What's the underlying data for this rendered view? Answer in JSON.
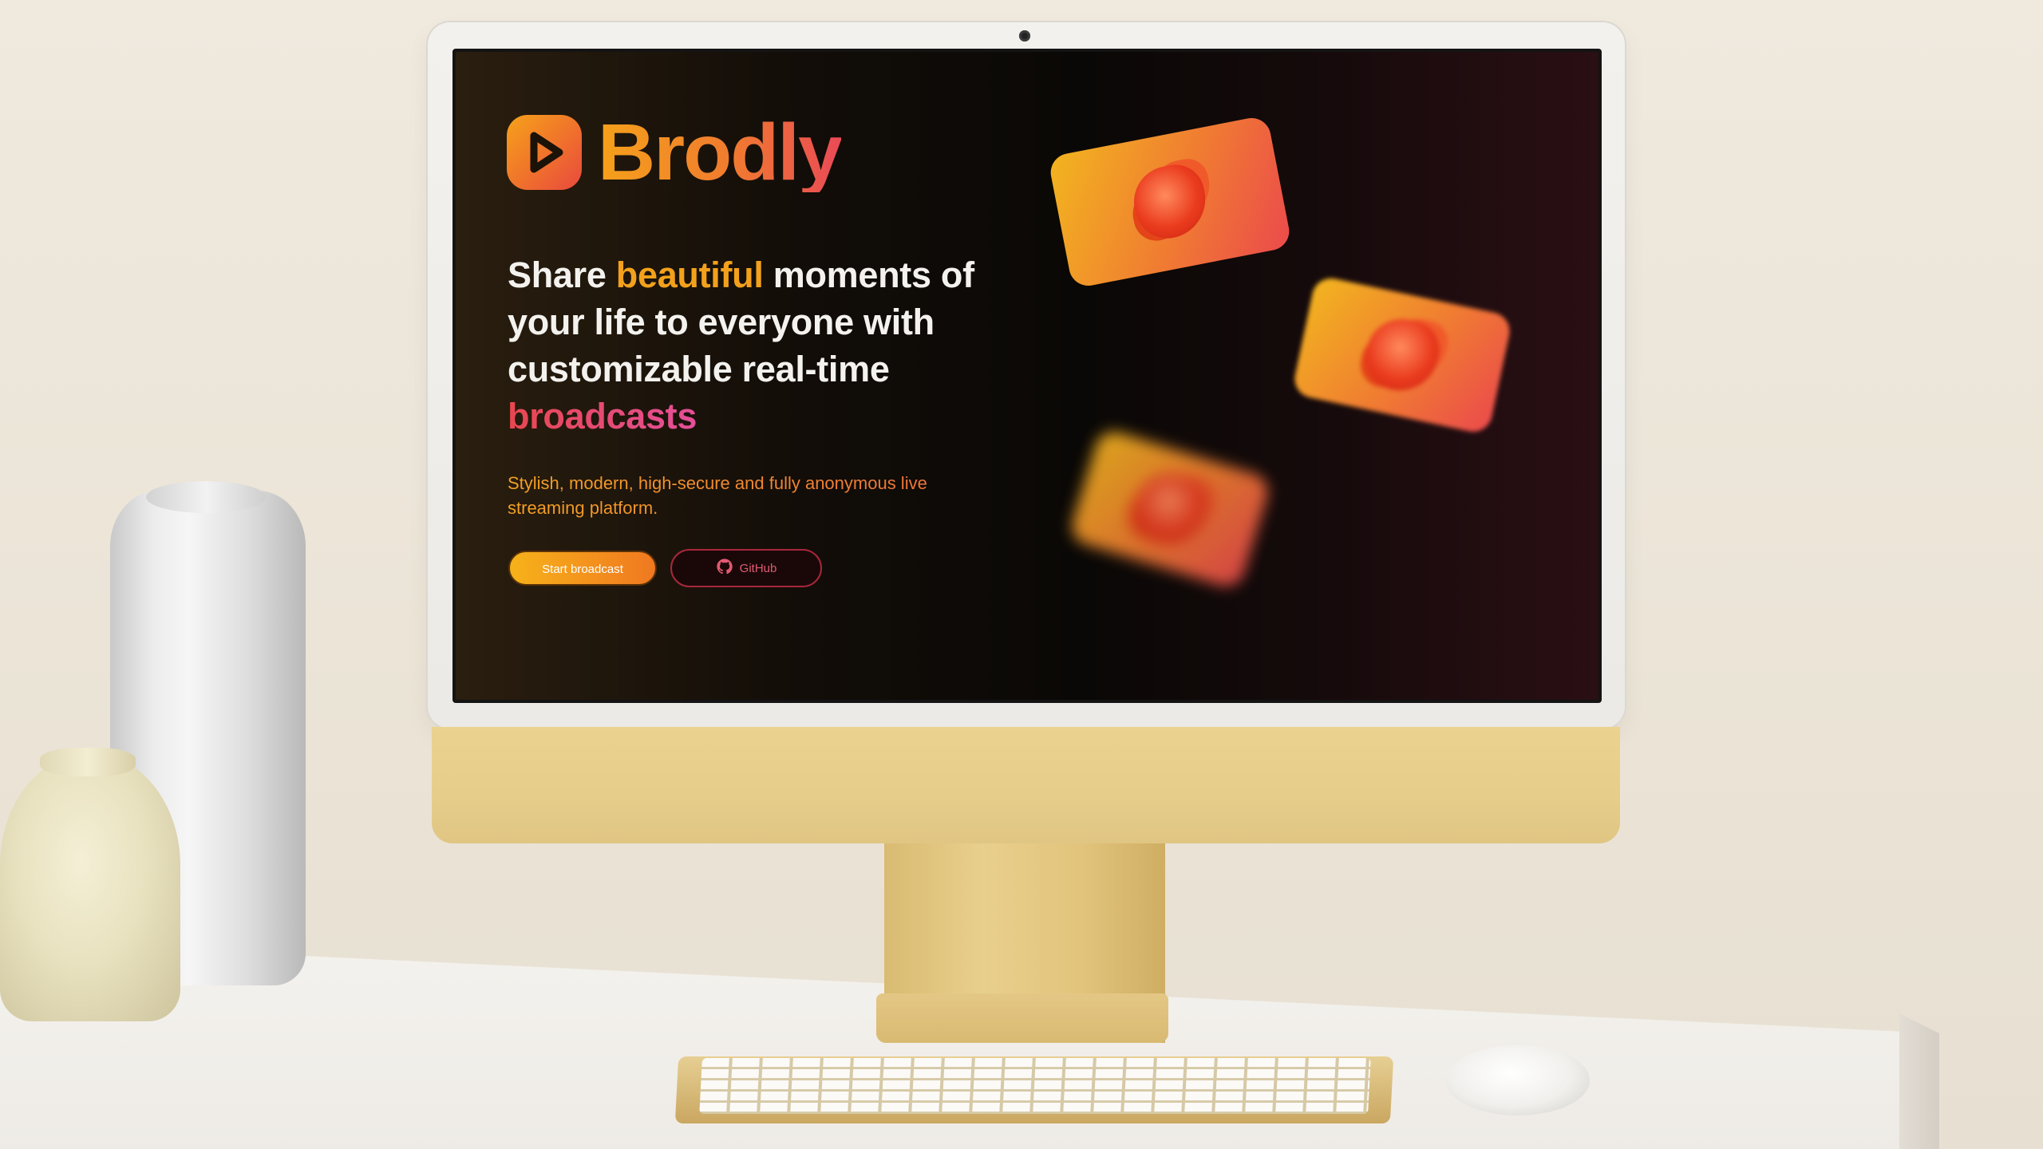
{
  "site": {
    "brand": "Brodly",
    "headline": {
      "part1": "Share ",
      "highlight1": "beautiful",
      "part2": " moments of your life to everyone with customizable real-time ",
      "highlight2": "broadcasts"
    },
    "subtext": "Stylish, modern, high-secure and fully anonymous live streaming platform.",
    "buttons": {
      "start": "Start broadcast",
      "github": "GitHub"
    }
  },
  "icons": {
    "logo": "play-icon",
    "github": "github-icon"
  },
  "colors": {
    "accent_orange": "#f3a11c",
    "accent_pink": "#e54f9a",
    "accent_red": "#e8474f",
    "screen_bg": "#0a0806"
  }
}
